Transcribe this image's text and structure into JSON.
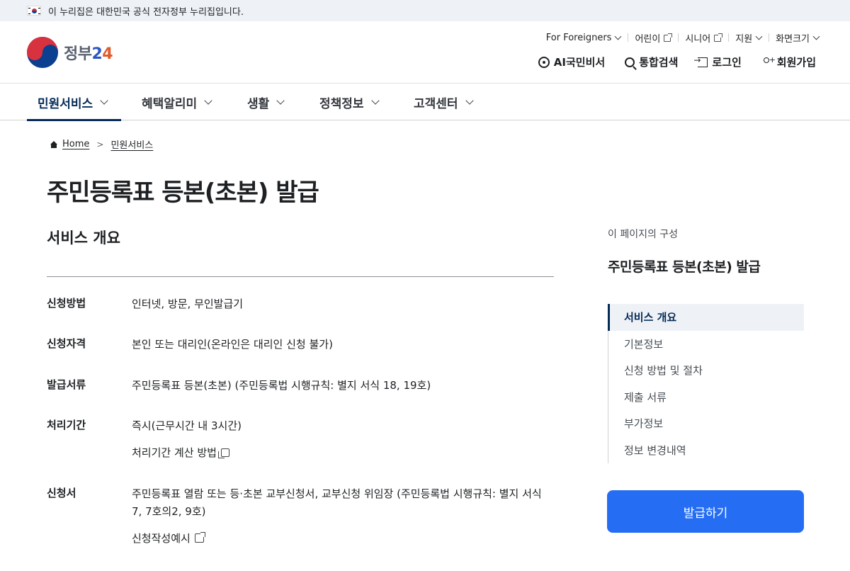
{
  "banner": {
    "text": "이 누리집은 대한민국 공식 전자정부 누리집입니다."
  },
  "logo": {
    "text_ko": "정부",
    "text_num": "2",
    "text_num2": "4"
  },
  "util_top": [
    {
      "label": "For Foreigners",
      "icon": "chevron-down-icon"
    },
    {
      "label": "어린이",
      "icon": "external-link-icon"
    },
    {
      "label": "시니어",
      "icon": "external-link-icon"
    },
    {
      "label": "지원",
      "icon": "chevron-down-icon"
    },
    {
      "label": "화면크기",
      "icon": "chevron-down-icon"
    }
  ],
  "util_main": [
    {
      "label": "AI국민비서",
      "icon": "ai-assistant-icon"
    },
    {
      "label": "통합검색",
      "icon": "search-icon"
    },
    {
      "label": "로그인",
      "icon": "login-icon"
    },
    {
      "label": "회원가입",
      "icon": "user-add-icon"
    }
  ],
  "gnb": [
    {
      "label": "민원서비스",
      "active": true
    },
    {
      "label": "혜택알리미"
    },
    {
      "label": "생활"
    },
    {
      "label": "정책정보"
    },
    {
      "label": "고객센터"
    }
  ],
  "breadcrumb": {
    "home": "Home",
    "current": "민원서비스"
  },
  "page_title": "주민등록표 등본(초본) 발급",
  "section": {
    "title": "서비스 개요",
    "rows": [
      {
        "label": "신청방법",
        "value": "인터넷, 방문, 무인발급기"
      },
      {
        "label": "신청자격",
        "value": "본인 또는 대리인(온라인은 대리인 신청 불가)"
      },
      {
        "label": "발급서류",
        "value": "주민등록표 등본(초본) (주민등록법 시행규칙: 별지 서식 18, 19호)"
      },
      {
        "label": "처리기간",
        "value": "즉시(근무시간 내 3시간)",
        "sub": "처리기간 계산 방법"
      },
      {
        "label": "신청서",
        "value": "주민등록표 열람 또는 등·초본 교부신청서, 교부신청 위임장 (주민등록법 시행규칙: 별지 서식 7, 7호의2, 9호)",
        "sub": "신청작성예시"
      }
    ]
  },
  "toc": {
    "caption": "이 페이지의 구성",
    "title": "주민등록표 등본(초본) 발급",
    "items": [
      "서비스 개요",
      "기본정보",
      "신청 방법 및 절차",
      "제출 서류",
      "부가정보",
      "정보 변경내역"
    ]
  },
  "issue_button": "발급하기",
  "colors": {
    "primary": "#256ef4",
    "navy": "#052b57",
    "banner_bg": "#eef1f5"
  }
}
